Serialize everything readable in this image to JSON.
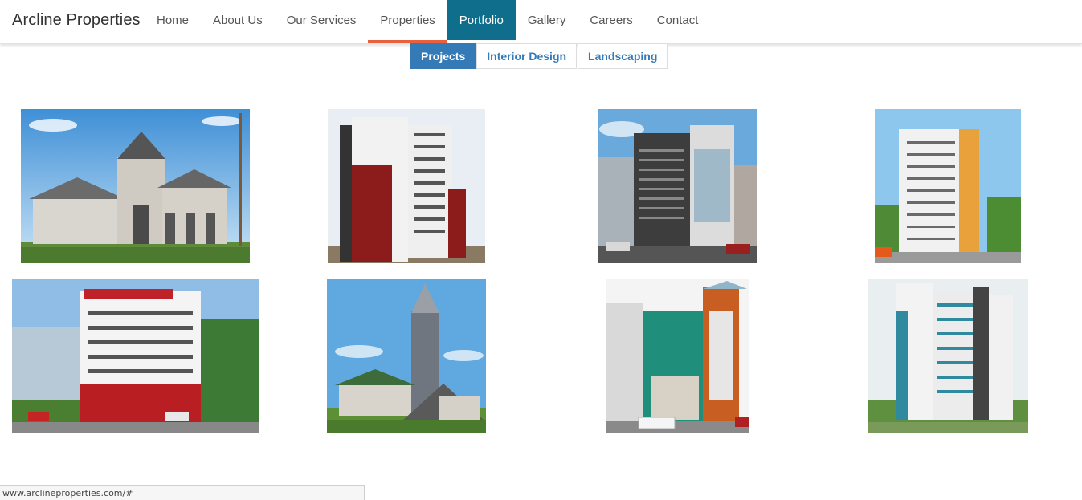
{
  "brand": "Arcline Properties",
  "nav": {
    "items": [
      {
        "label": "Home"
      },
      {
        "label": "About Us"
      },
      {
        "label": "Our Services"
      },
      {
        "label": "Properties"
      },
      {
        "label": "Portfolio"
      },
      {
        "label": "Gallery"
      },
      {
        "label": "Careers"
      },
      {
        "label": "Contact"
      }
    ],
    "active": "Portfolio",
    "hovered": "Properties"
  },
  "tabs": {
    "items": [
      {
        "label": "Projects"
      },
      {
        "label": "Interior Design"
      },
      {
        "label": "Landscaping"
      }
    ],
    "active": "Projects"
  },
  "gallery": {
    "images": [
      {
        "icon": "church-building-image"
      },
      {
        "icon": "highrise-red-white-image"
      },
      {
        "icon": "commercial-glass-building-image"
      },
      {
        "icon": "apartment-tower-orange-image"
      },
      {
        "icon": "office-building-red-white-image"
      },
      {
        "icon": "church-with-spire-image"
      },
      {
        "icon": "commercial-teal-glass-image"
      },
      {
        "icon": "highrise-blue-white-image"
      }
    ]
  },
  "status_bar": {
    "url": "www.arclineproperties.com/#"
  },
  "colors": {
    "nav_active_bg": "#0f6e8c",
    "nav_underline": "#e8603c",
    "tab_active_bg": "#337ab7",
    "tab_text": "#337ab7"
  }
}
